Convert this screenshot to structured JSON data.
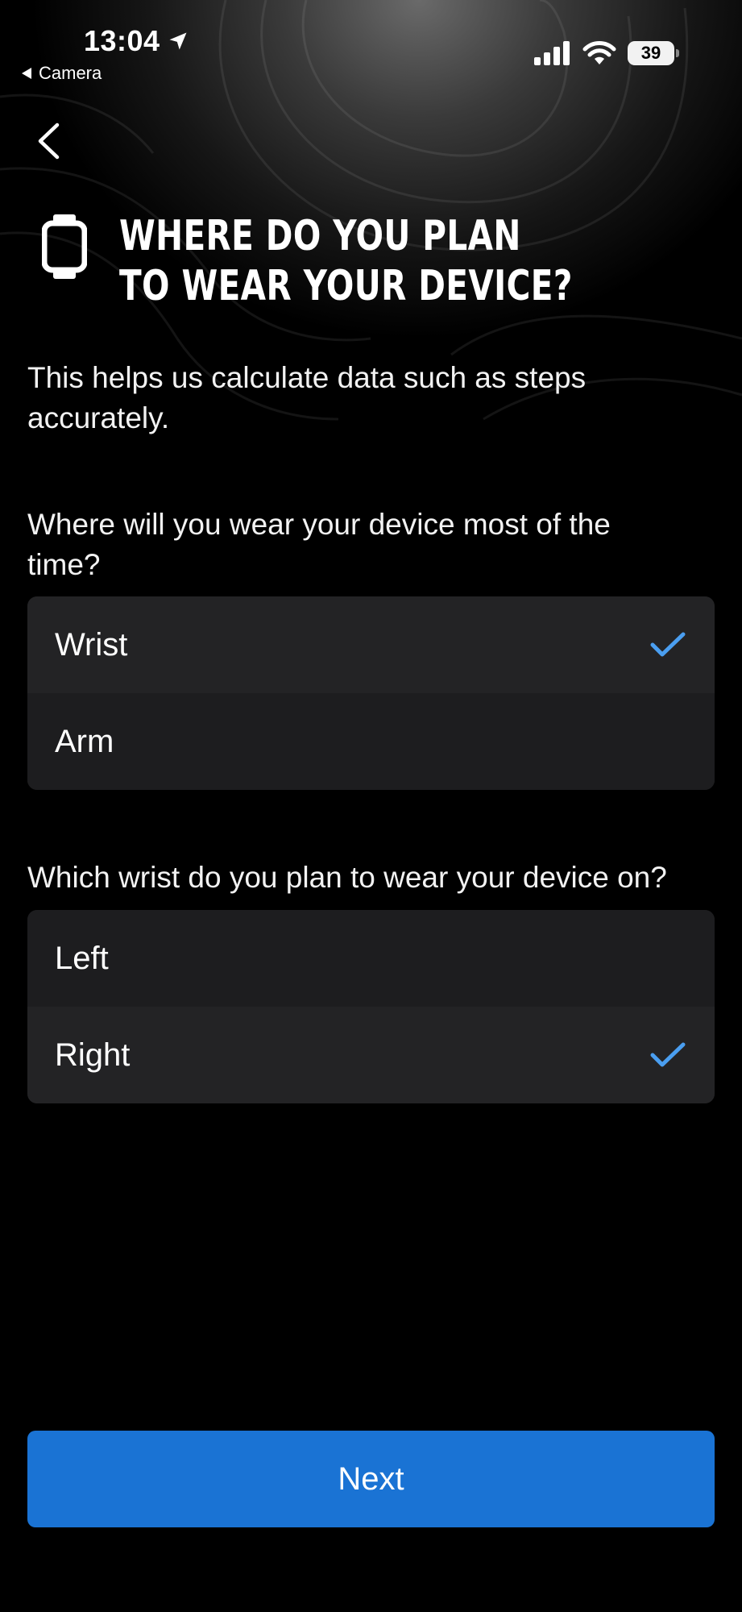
{
  "status_bar": {
    "time": "13:04",
    "back_app": "Camera",
    "battery": "39"
  },
  "header": {
    "title": "WHERE DO YOU PLAN TO WEAR YOUR DEVICE?",
    "subtitle": "This helps us calculate data such as steps accurately."
  },
  "location_question": {
    "label": "Where will you wear your device most of the time?",
    "options": [
      {
        "label": "Wrist",
        "selected": true
      },
      {
        "label": "Arm",
        "selected": false
      }
    ]
  },
  "wrist_question": {
    "label": "Which wrist do you plan to wear your device on?",
    "options": [
      {
        "label": "Left",
        "selected": false
      },
      {
        "label": "Right",
        "selected": true
      }
    ]
  },
  "footer": {
    "next_label": "Next"
  },
  "colors": {
    "accent": "#1a73d4",
    "check": "#4a9ef0",
    "row_bg": "#1d1d1f"
  },
  "icons": [
    "location-arrow-icon",
    "back-triangle-icon",
    "signal-icon",
    "wifi-icon",
    "battery-icon",
    "chevron-left-icon",
    "watch-icon",
    "checkmark-icon"
  ]
}
